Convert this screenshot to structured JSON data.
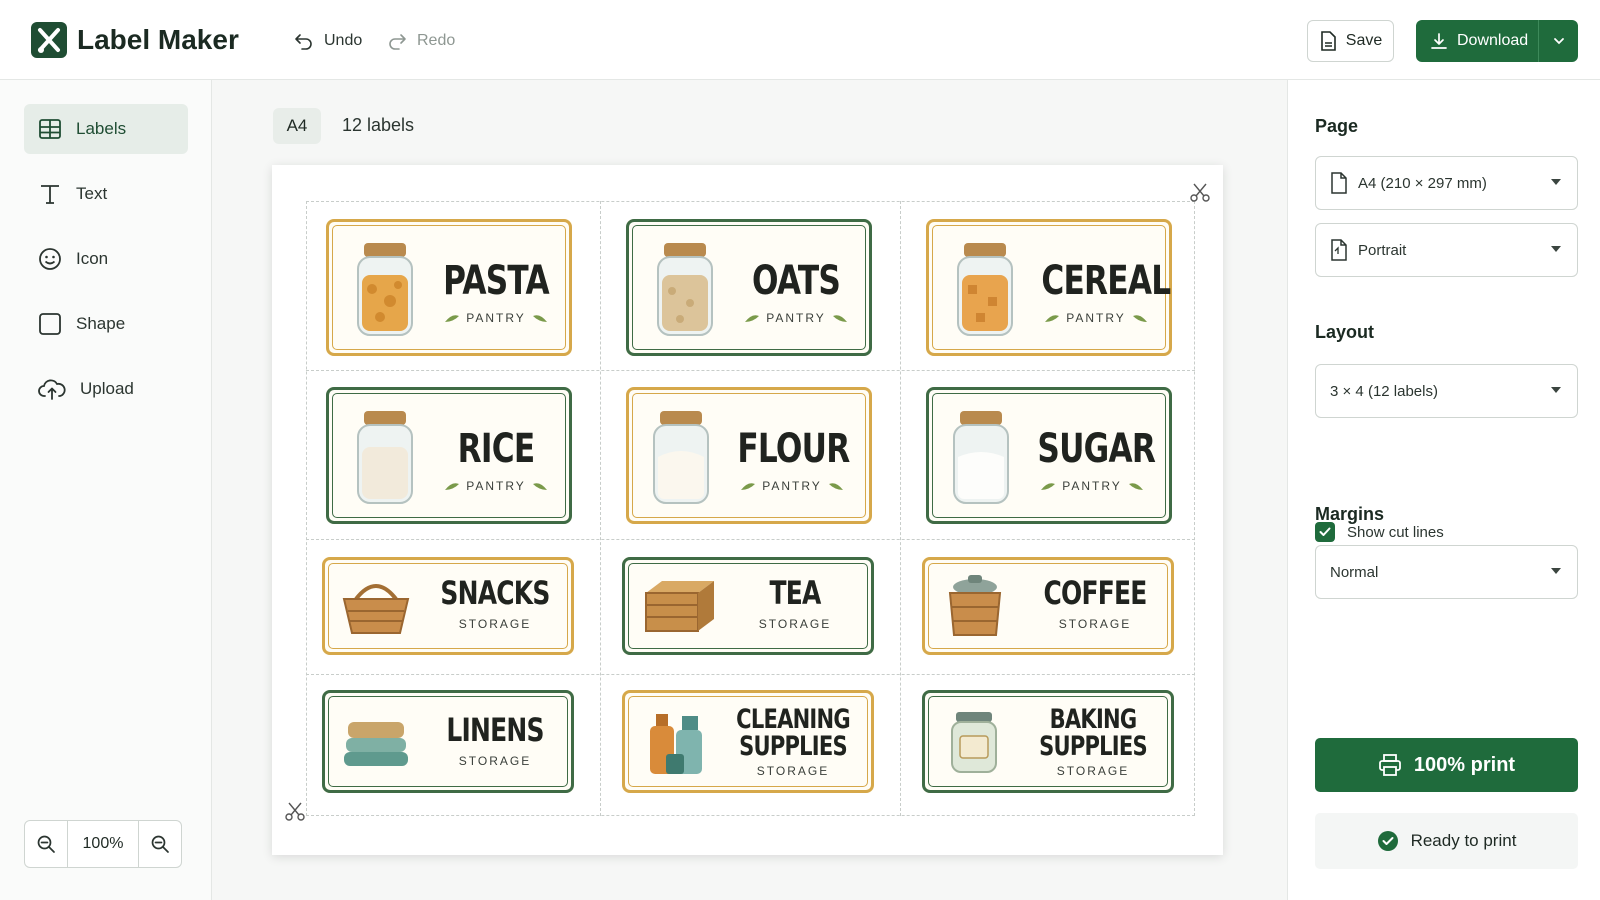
{
  "app": {
    "title": "Label Maker"
  },
  "toolbar": {
    "undo": "Undo",
    "redo": "Redo",
    "save": "Save",
    "download": "Download"
  },
  "sidebar": {
    "items": [
      {
        "label": "Labels",
        "icon": "grid-icon",
        "active": true
      },
      {
        "label": "Text",
        "icon": "text-icon"
      },
      {
        "label": "Icon",
        "icon": "smiley-icon"
      },
      {
        "label": "Shape",
        "icon": "square-icon"
      },
      {
        "label": "Upload",
        "icon": "cloud-upload-icon"
      }
    ],
    "zoom": "100%"
  },
  "canvas": {
    "paper_chip": "A4",
    "count_text": "12 labels"
  },
  "labels": [
    {
      "name": "PASTA",
      "sub": "PANTRY",
      "border": "yellow",
      "art": "pasta-jar"
    },
    {
      "name": "OATS",
      "sub": "PANTRY",
      "border": "green",
      "art": "oats-jar"
    },
    {
      "name": "CEREAL",
      "sub": "PANTRY",
      "border": "yellow",
      "art": "cereal-jar"
    },
    {
      "name": "RICE",
      "sub": "PANTRY",
      "border": "green",
      "art": "rice-jar"
    },
    {
      "name": "FLOUR",
      "sub": "PANTRY",
      "border": "yellow",
      "art": "flour-jar"
    },
    {
      "name": "SUGAR",
      "sub": "PANTRY",
      "border": "green",
      "art": "sugar-jar"
    },
    {
      "name": "SNACKS",
      "sub": "STORAGE",
      "border": "yellow",
      "art": "basket"
    },
    {
      "name": "TEA",
      "sub": "STORAGE",
      "border": "green",
      "art": "crate"
    },
    {
      "name": "COFFEE",
      "sub": "STORAGE",
      "border": "yellow",
      "art": "lidded-basket"
    },
    {
      "name": "LINENS",
      "sub": "STORAGE",
      "border": "green",
      "art": "towels"
    },
    {
      "name_lines": [
        "CLEANING",
        "SUPPLIES"
      ],
      "sub": "STORAGE",
      "border": "yellow",
      "art": "bottles"
    },
    {
      "name_lines": [
        "BAKING",
        "SUPPLIES"
      ],
      "sub": "STORAGE",
      "border": "green",
      "art": "baking-jar"
    }
  ],
  "panel": {
    "page_title": "Page",
    "page_size": "A4 (210 × 297 mm)",
    "orientation": "Portrait",
    "layout_title": "Layout",
    "layout_value": "3 × 4 (12 labels)",
    "cut_lines_label": "Show cut lines",
    "cut_lines_checked": true,
    "margins_title": "Margins",
    "margins_value": "Normal",
    "print_button": "100% print",
    "status": "Ready to print"
  },
  "colors": {
    "brand": "#1f6b3c",
    "label_green": "#3f6b45",
    "label_yellow": "#d6a84a"
  }
}
